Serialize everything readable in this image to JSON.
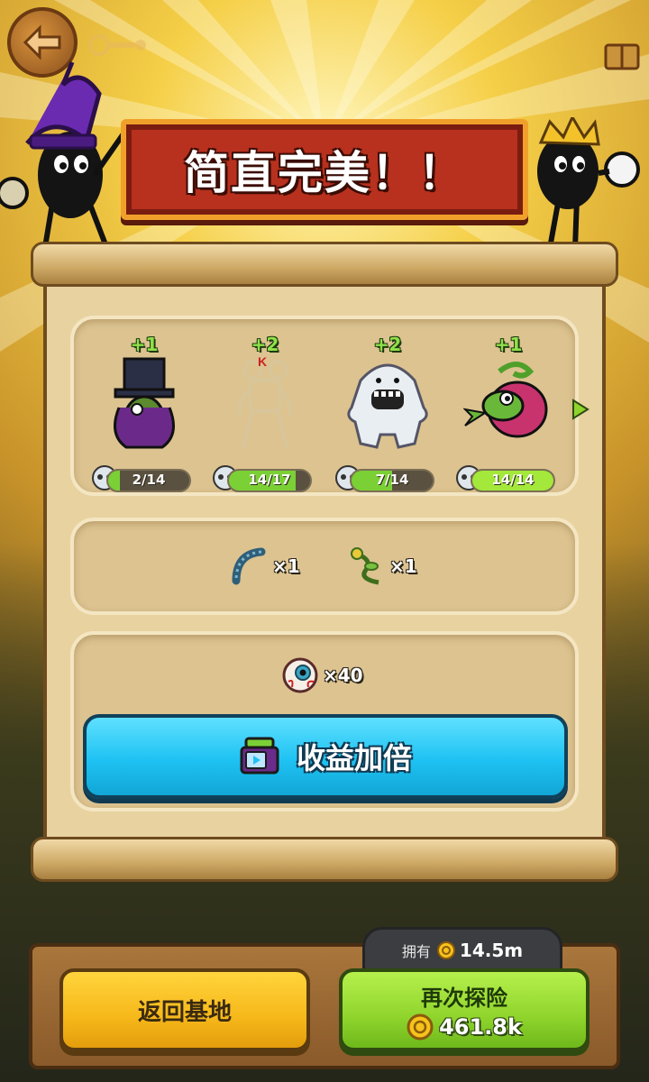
{
  "banner": {
    "title": "简直完美！！"
  },
  "heroes": [
    {
      "name_icon": "top-hat-mage-icon",
      "bonus": "+1",
      "progress_text": "2/14",
      "progress": 0.14,
      "bar_color": "#7bd036"
    },
    {
      "name_icon": "rope-king-icon",
      "bonus": "+2",
      "progress_text": "14/17",
      "progress": 0.82,
      "bar_color": "#7bd036"
    },
    {
      "name_icon": "yeti-icon",
      "bonus": "+2",
      "progress_text": "7/14",
      "progress": 0.5,
      "bar_color": "#7bd036"
    },
    {
      "name_icon": "pink-chameleon-icon",
      "bonus": "+1",
      "progress_text": "14/14",
      "progress": 1.0,
      "bar_color": "#a3e83a"
    }
  ],
  "loot": [
    {
      "icon": "blue-centipede-icon",
      "count": "×1"
    },
    {
      "icon": "green-vine-icon",
      "count": "×1"
    }
  ],
  "currency_reward": {
    "icon": "eyeball-icon",
    "count": "×40"
  },
  "double_button": {
    "icon": "tv-ad-icon",
    "label": "收益加倍"
  },
  "owned": {
    "label": "拥有",
    "icon": "gold-coin-icon",
    "value": "14.5m"
  },
  "home_button": {
    "label": "返回基地"
  },
  "again_button": {
    "label": "再次探险",
    "cost": "461.8k",
    "icon": "gold-coin-icon"
  },
  "colors": {
    "accent_blue": "#1ec2f2",
    "accent_green": "#8fd42c",
    "accent_yellow": "#f6b81a",
    "banner_red": "#b8301e"
  }
}
